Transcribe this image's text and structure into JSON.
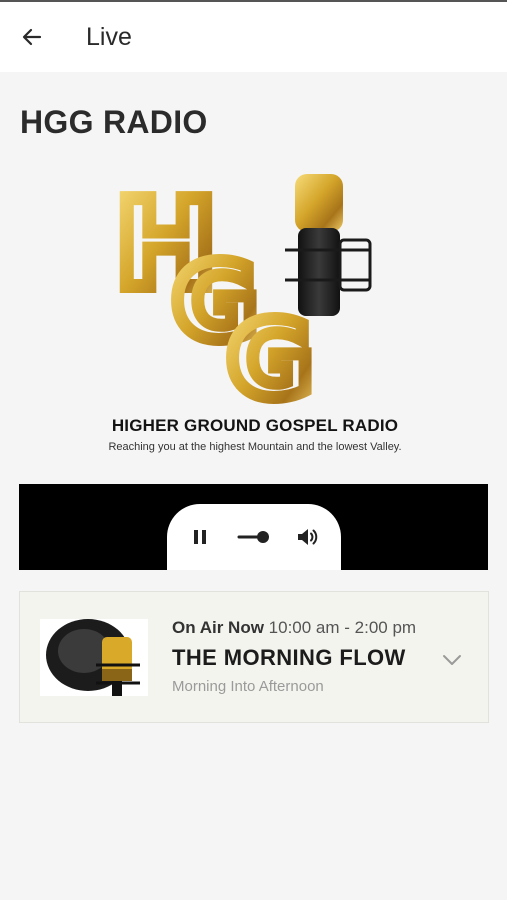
{
  "appbar": {
    "title": "Live"
  },
  "page": {
    "title": "HGG RADIO"
  },
  "logo": {
    "letters": [
      "H",
      "G",
      "G"
    ],
    "name": "HIGHER GROUND GOSPEL RADIO",
    "tagline": "Reaching you at the highest Mountain and the lowest Valley.",
    "gold": "#d4a52a"
  },
  "player": {
    "state_icon": "pause-icon",
    "volume_icon": "volume-icon",
    "background": "#000000"
  },
  "now_playing": {
    "label": "On Air Now",
    "time": "10:00 am - 2:00 pm",
    "title": "THE MORNING FLOW",
    "subtitle": "Morning Into Afternoon",
    "expand_icon": "chevron-down-icon"
  }
}
